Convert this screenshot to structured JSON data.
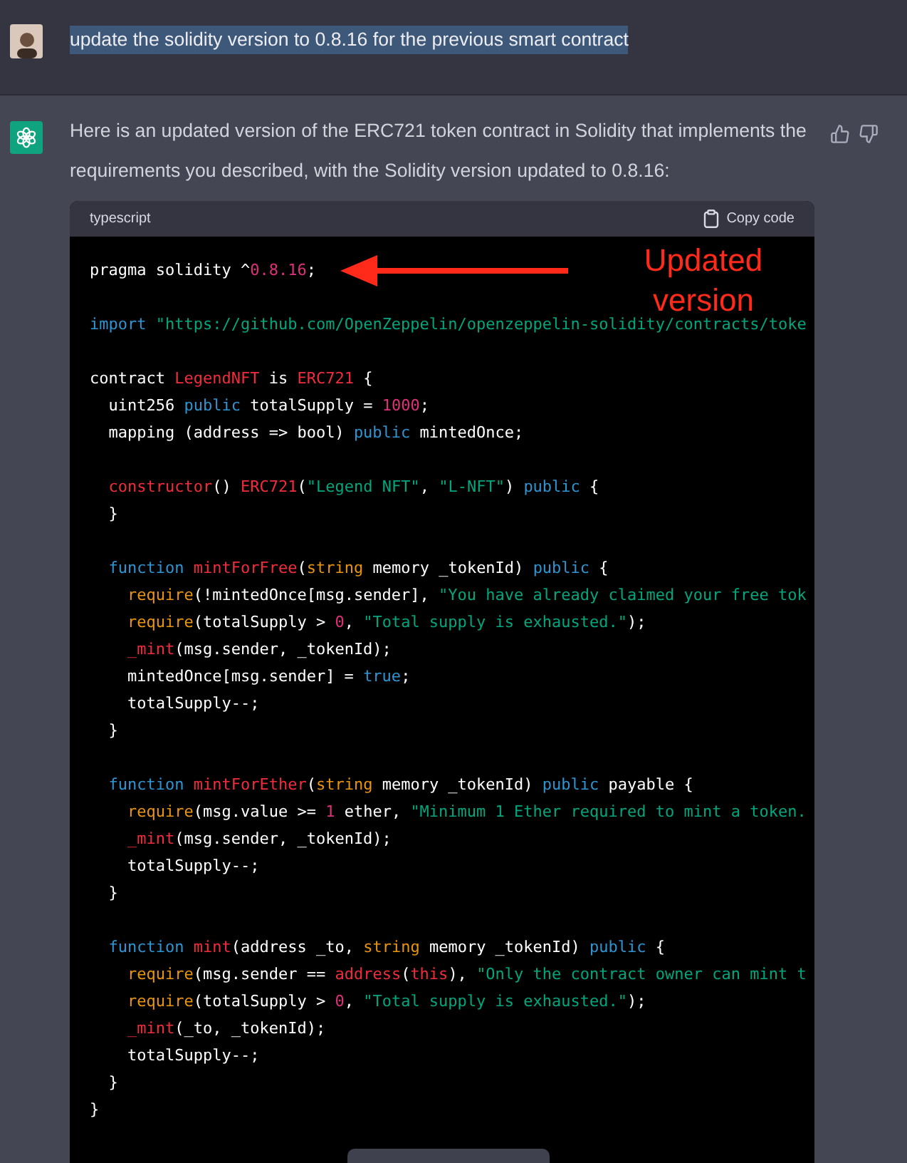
{
  "user_message": {
    "text": "update the solidity version to 0.8.16 for the previous smart contract",
    "selected": true
  },
  "assistant_message": {
    "text": "Here is an updated version of the ERC721 token contract in Solidity that implements the requirements you described, with the Solidity version updated to 0.8.16:",
    "code_block": {
      "language": "typescript",
      "copy_label": "Copy code",
      "lines": [
        {
          "kind": "code",
          "tokens": [
            {
              "kind": "plain",
              "text": "pragma solidity ^"
            },
            {
              "kind": "number",
              "text": "0.8.16"
            },
            {
              "kind": "plain",
              "text": ";"
            }
          ]
        },
        {
          "kind": "blank"
        },
        {
          "kind": "code",
          "tokens": [
            {
              "kind": "keyword",
              "text": "import"
            },
            {
              "kind": "string",
              "text": " \"https://github.com/OpenZeppelin/openzeppelin-solidity/contracts/toke"
            }
          ]
        },
        {
          "kind": "blank"
        },
        {
          "kind": "code",
          "tokens": [
            {
              "kind": "plain",
              "text": "contract "
            },
            {
              "kind": "title",
              "text": "LegendNFT"
            },
            {
              "kind": "plain",
              "text": " is "
            },
            {
              "kind": "title",
              "text": "ERC721"
            },
            {
              "kind": "plain",
              "text": " {"
            }
          ]
        },
        {
          "kind": "code",
          "tokens": [
            {
              "kind": "plain",
              "text": "  uint256 "
            },
            {
              "kind": "keyword",
              "text": "public"
            },
            {
              "kind": "plain",
              "text": " totalSupply = "
            },
            {
              "kind": "number",
              "text": "1000"
            },
            {
              "kind": "plain",
              "text": ";"
            }
          ]
        },
        {
          "kind": "code",
          "tokens": [
            {
              "kind": "plain",
              "text": "  mapping (address => bool) "
            },
            {
              "kind": "keyword",
              "text": "public"
            },
            {
              "kind": "plain",
              "text": " mintedOnce;"
            }
          ]
        },
        {
          "kind": "blank"
        },
        {
          "kind": "code",
          "tokens": [
            {
              "kind": "title",
              "text": "  constructor"
            },
            {
              "kind": "plain",
              "text": "() "
            },
            {
              "kind": "title",
              "text": "ERC721"
            },
            {
              "kind": "plain",
              "text": "("
            },
            {
              "kind": "string",
              "text": "\"Legend NFT\""
            },
            {
              "kind": "plain",
              "text": ", "
            },
            {
              "kind": "string",
              "text": "\"L-NFT\""
            },
            {
              "kind": "plain",
              "text": ") "
            },
            {
              "kind": "keyword",
              "text": "public"
            },
            {
              "kind": "plain",
              "text": " {"
            }
          ]
        },
        {
          "kind": "code",
          "tokens": [
            {
              "kind": "plain",
              "text": "  }"
            }
          ]
        },
        {
          "kind": "blank"
        },
        {
          "kind": "code",
          "tokens": [
            {
              "kind": "keyword",
              "text": "  function"
            },
            {
              "kind": "title",
              "text": " mintForFree"
            },
            {
              "kind": "plain",
              "text": "("
            },
            {
              "kind": "builtin",
              "text": "string"
            },
            {
              "kind": "plain",
              "text": " memory _tokenId) "
            },
            {
              "kind": "keyword",
              "text": "public"
            },
            {
              "kind": "plain",
              "text": " {"
            }
          ]
        },
        {
          "kind": "code",
          "tokens": [
            {
              "kind": "builtin",
              "text": "    require"
            },
            {
              "kind": "plain",
              "text": "(!mintedOnce[msg.sender], "
            },
            {
              "kind": "string",
              "text": "\"You have already claimed your free tok"
            }
          ]
        },
        {
          "kind": "code",
          "tokens": [
            {
              "kind": "builtin",
              "text": "    require"
            },
            {
              "kind": "plain",
              "text": "(totalSupply > "
            },
            {
              "kind": "number",
              "text": "0"
            },
            {
              "kind": "plain",
              "text": ", "
            },
            {
              "kind": "string",
              "text": "\"Total supply is exhausted.\""
            },
            {
              "kind": "plain",
              "text": ");"
            }
          ]
        },
        {
          "kind": "code",
          "tokens": [
            {
              "kind": "title",
              "text": "    _mint"
            },
            {
              "kind": "plain",
              "text": "(msg.sender, _tokenId);"
            }
          ]
        },
        {
          "kind": "code",
          "tokens": [
            {
              "kind": "plain",
              "text": "    mintedOnce[msg.sender] = "
            },
            {
              "kind": "keyword",
              "text": "true"
            },
            {
              "kind": "plain",
              "text": ";"
            }
          ]
        },
        {
          "kind": "code",
          "tokens": [
            {
              "kind": "plain",
              "text": "    totalSupply--;"
            }
          ]
        },
        {
          "kind": "code",
          "tokens": [
            {
              "kind": "plain",
              "text": "  }"
            }
          ]
        },
        {
          "kind": "blank"
        },
        {
          "kind": "code",
          "tokens": [
            {
              "kind": "keyword",
              "text": "  function"
            },
            {
              "kind": "title",
              "text": " mintForEther"
            },
            {
              "kind": "plain",
              "text": "("
            },
            {
              "kind": "builtin",
              "text": "string"
            },
            {
              "kind": "plain",
              "text": " memory _tokenId) "
            },
            {
              "kind": "keyword",
              "text": "public"
            },
            {
              "kind": "plain",
              "text": " payable {"
            }
          ]
        },
        {
          "kind": "code",
          "tokens": [
            {
              "kind": "builtin",
              "text": "    require"
            },
            {
              "kind": "plain",
              "text": "(msg.value >= "
            },
            {
              "kind": "number",
              "text": "1"
            },
            {
              "kind": "plain",
              "text": " ether, "
            },
            {
              "kind": "string",
              "text": "\"Minimum 1 Ether required to mint a token."
            }
          ]
        },
        {
          "kind": "code",
          "tokens": [
            {
              "kind": "title",
              "text": "    _mint"
            },
            {
              "kind": "plain",
              "text": "(msg.sender, _tokenId);"
            }
          ]
        },
        {
          "kind": "code",
          "tokens": [
            {
              "kind": "plain",
              "text": "    totalSupply--;"
            }
          ]
        },
        {
          "kind": "code",
          "tokens": [
            {
              "kind": "plain",
              "text": "  }"
            }
          ]
        },
        {
          "kind": "blank"
        },
        {
          "kind": "code",
          "tokens": [
            {
              "kind": "keyword",
              "text": "  function"
            },
            {
              "kind": "title",
              "text": " mint"
            },
            {
              "kind": "plain",
              "text": "(address _to, "
            },
            {
              "kind": "builtin",
              "text": "string"
            },
            {
              "kind": "plain",
              "text": " memory _tokenId) "
            },
            {
              "kind": "keyword",
              "text": "public"
            },
            {
              "kind": "plain",
              "text": " {"
            }
          ]
        },
        {
          "kind": "code",
          "tokens": [
            {
              "kind": "builtin",
              "text": "    require"
            },
            {
              "kind": "plain",
              "text": "(msg.sender == "
            },
            {
              "kind": "title",
              "text": "address"
            },
            {
              "kind": "plain",
              "text": "("
            },
            {
              "kind": "title",
              "text": "this"
            },
            {
              "kind": "plain",
              "text": "), "
            },
            {
              "kind": "string",
              "text": "\"Only the contract owner can mint t"
            }
          ]
        },
        {
          "kind": "code",
          "tokens": [
            {
              "kind": "builtin",
              "text": "    require"
            },
            {
              "kind": "plain",
              "text": "(totalSupply > "
            },
            {
              "kind": "number",
              "text": "0"
            },
            {
              "kind": "plain",
              "text": ", "
            },
            {
              "kind": "string",
              "text": "\"Total supply is exhausted.\""
            },
            {
              "kind": "plain",
              "text": ");"
            }
          ]
        },
        {
          "kind": "code",
          "tokens": [
            {
              "kind": "title",
              "text": "    _mint"
            },
            {
              "kind": "plain",
              "text": "(_to, _tokenId);"
            }
          ]
        },
        {
          "kind": "code",
          "tokens": [
            {
              "kind": "plain",
              "text": "    totalSupply--;"
            }
          ]
        },
        {
          "kind": "code",
          "tokens": [
            {
              "kind": "plain",
              "text": "  }"
            }
          ]
        },
        {
          "kind": "code",
          "tokens": [
            {
              "kind": "plain",
              "text": "}"
            }
          ]
        }
      ]
    }
  },
  "annotation": {
    "text": "Updated version"
  }
}
